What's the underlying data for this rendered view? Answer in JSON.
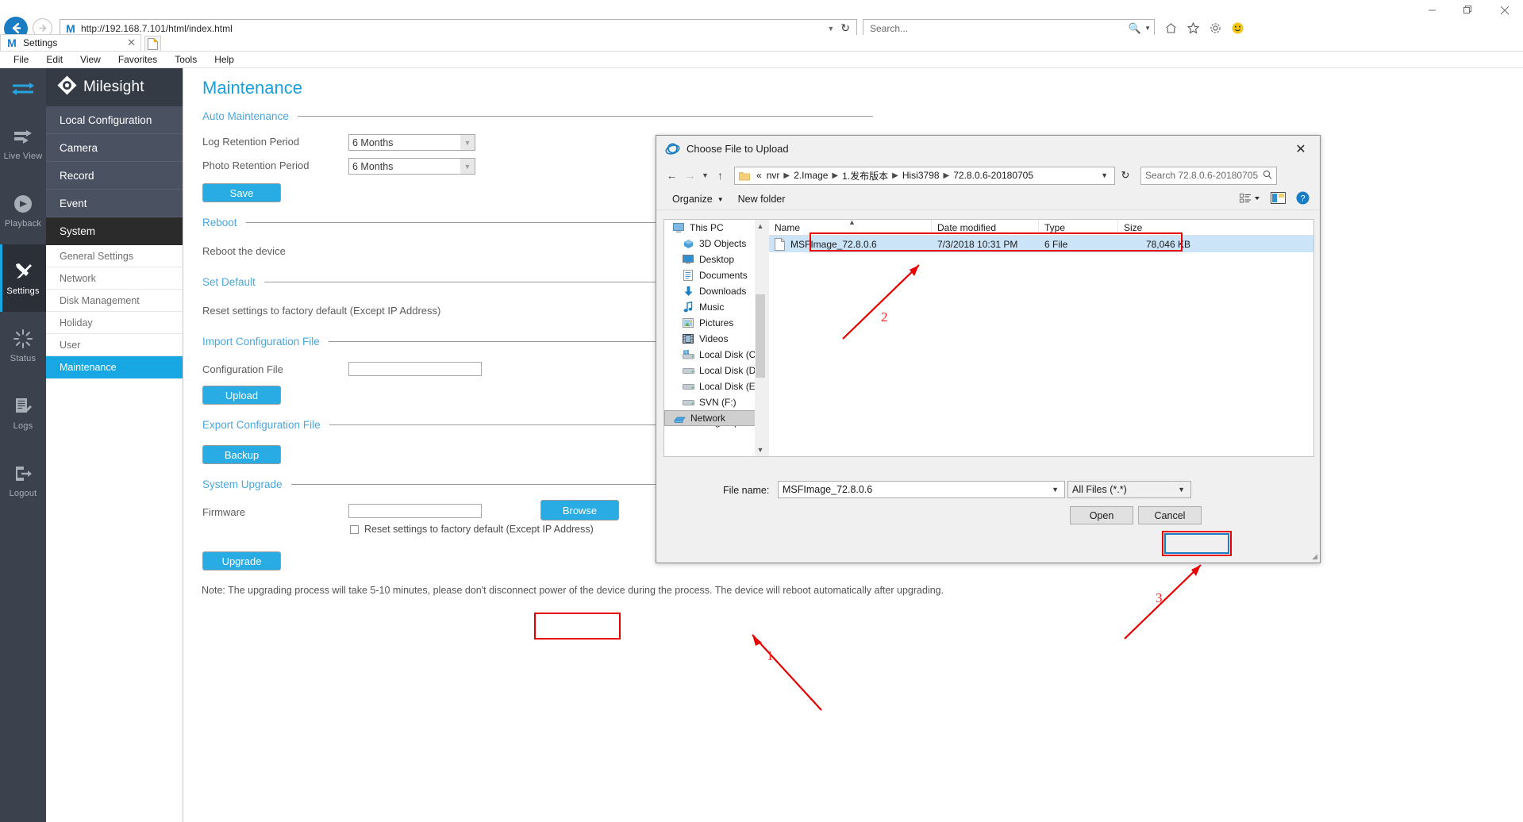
{
  "browser": {
    "window_controls": [
      "minimize",
      "restore",
      "close"
    ],
    "address": {
      "url": "http://192.168.7.101/html/index.html",
      "favicon": "M",
      "dropdown_icon": "chevron-down-icon",
      "refresh_icon": "refresh-icon"
    },
    "search": {
      "placeholder": "Search...",
      "icon": "search-icon"
    },
    "toolbar_icons": [
      "home-icon",
      "favorites-star-icon",
      "gear-icon",
      "smiley-icon"
    ],
    "tab": {
      "title": "Settings",
      "favicon": "M",
      "close": "✕"
    },
    "new_tab_label": "new-tab",
    "menu": [
      "File",
      "Edit",
      "View",
      "Favorites",
      "Tools",
      "Help"
    ]
  },
  "rail": {
    "toggle_icon": "collapse-arrows-icon",
    "items": [
      {
        "label": "Live View",
        "icon": "liveview-icon",
        "active": false
      },
      {
        "label": "Playback",
        "icon": "playback-icon",
        "active": false
      },
      {
        "label": "Settings",
        "icon": "tools-icon",
        "active": true
      },
      {
        "label": "Status",
        "icon": "status-icon",
        "active": false
      },
      {
        "label": "Logs",
        "icon": "logs-icon",
        "active": false
      },
      {
        "label": "Logout",
        "icon": "logout-icon",
        "active": false
      }
    ]
  },
  "brand": {
    "name": "Milesight",
    "logo": "milesight-diamond-logo"
  },
  "nav": {
    "primary": [
      {
        "label": "Local Configuration",
        "selected": false
      },
      {
        "label": "Camera",
        "selected": false
      },
      {
        "label": "Record",
        "selected": false
      },
      {
        "label": "Event",
        "selected": false
      },
      {
        "label": "System",
        "selected": true
      }
    ],
    "secondary": [
      {
        "label": "General Settings",
        "active": false
      },
      {
        "label": "Network",
        "active": false
      },
      {
        "label": "Disk Management",
        "active": false
      },
      {
        "label": "Holiday",
        "active": false
      },
      {
        "label": "User",
        "active": false
      },
      {
        "label": "Maintenance",
        "active": true
      }
    ]
  },
  "content": {
    "title": "Maintenance",
    "sections": {
      "auto_maintenance": "Auto Maintenance",
      "reboot": "Reboot",
      "set_default": "Set Default",
      "import_config": "Import Configuration File",
      "export_config": "Export Configuration File",
      "system_upgrade": "System Upgrade"
    },
    "log_retention_label": "Log Retention Period",
    "log_retention_value": "6 Months",
    "photo_retention_label": "Photo Retention Period",
    "photo_retention_value": "6 Months",
    "save_button": "Save",
    "reboot_text": "Reboot the device",
    "set_default_text": "Reset settings to factory default (Except IP Address)",
    "configuration_file_label": "Configuration File",
    "configuration_file_value": "",
    "upload_button": "Upload",
    "backup_button": "Backup",
    "firmware_label": "Firmware",
    "firmware_value": "",
    "browse_button": "Browse",
    "reset_checkbox_label": "Reset settings to factory default (Except IP Address)",
    "reset_checkbox_checked": false,
    "upgrade_button": "Upgrade",
    "note": "Note: The upgrading process will take 5-10 minutes, please don't disconnect power of the device during the process. The device will reboot automatically after upgrading."
  },
  "annotations": {
    "accent_red": "#e60000",
    "markers": [
      {
        "number": "1",
        "points_to": "browse-button"
      },
      {
        "number": "2",
        "points_to": "file-row"
      },
      {
        "number": "3",
        "points_to": "open-button"
      }
    ]
  },
  "dialog": {
    "title": "Choose File to Upload",
    "title_icon": "internet-explorer-icon",
    "close_icon": "close-icon",
    "nav": {
      "back_icon": "arrow-left-icon",
      "forward_icon": "arrow-right-icon",
      "recent_icon": "chevron-down-icon",
      "up_icon": "arrow-up-icon",
      "refresh_icon": "refresh-icon"
    },
    "breadcrumb": {
      "prefix": "«",
      "items": [
        "nvr",
        "2.Image",
        "1.发布版本",
        "Hisi3798",
        "72.8.0.6-20180705"
      ],
      "folder_icon": "folder-icon"
    },
    "search_placeholder": "Search 72.8.0.6-20180705",
    "search_icon": "search-icon",
    "toolbar": {
      "organize": "Organize",
      "new_folder": "New folder",
      "view_icon": "view-list-icon",
      "preview_icon": "preview-pane-icon",
      "help_icon": "help-icon"
    },
    "nav_pane": [
      {
        "label": "This PC",
        "icon": "this-pc-icon",
        "indent": 0,
        "selected": false
      },
      {
        "label": "3D Objects",
        "icon": "3d-objects-icon",
        "indent": 1,
        "selected": false
      },
      {
        "label": "Desktop",
        "icon": "desktop-icon",
        "indent": 1,
        "selected": false
      },
      {
        "label": "Documents",
        "icon": "documents-icon",
        "indent": 1,
        "selected": false
      },
      {
        "label": "Downloads",
        "icon": "downloads-icon",
        "indent": 1,
        "selected": false
      },
      {
        "label": "Music",
        "icon": "music-icon",
        "indent": 1,
        "selected": false
      },
      {
        "label": "Pictures",
        "icon": "pictures-icon",
        "indent": 1,
        "selected": false
      },
      {
        "label": "Videos",
        "icon": "videos-icon",
        "indent": 1,
        "selected": false
      },
      {
        "label": "Local Disk (C:)",
        "icon": "windows-drive-icon",
        "indent": 1,
        "selected": false
      },
      {
        "label": "Local Disk (D:)",
        "icon": "drive-icon",
        "indent": 1,
        "selected": false
      },
      {
        "label": "Local Disk (E:)",
        "icon": "drive-icon",
        "indent": 1,
        "selected": false
      },
      {
        "label": "SVN (F:)",
        "icon": "drive-icon",
        "indent": 1,
        "selected": false
      },
      {
        "label": "Network",
        "icon": "network-icon",
        "indent": 0,
        "selected": true
      },
      {
        "label": "Homegroup",
        "icon": "homegroup-icon",
        "indent": 0,
        "selected": false
      }
    ],
    "columns": [
      "Name",
      "Date modified",
      "Type",
      "Size"
    ],
    "sorted_column": "Name",
    "rows": [
      {
        "name": "MSFImage_72.8.0.6",
        "date_modified": "7/3/2018 10:31 PM",
        "type": "6 File",
        "size": "78,046 KB",
        "icon": "file-icon",
        "selected": true
      }
    ],
    "file_name_label": "File name:",
    "file_name_value": "MSFImage_72.8.0.6",
    "filter_value": "All Files (*.*)",
    "open_button": "Open",
    "cancel_button": "Cancel"
  }
}
